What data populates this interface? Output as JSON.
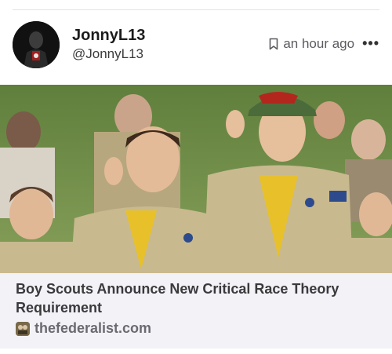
{
  "post": {
    "display_name": "JonnyL13",
    "handle": "@JonnyL13",
    "timestamp": "an hour ago",
    "more_label": "•••"
  },
  "link_card": {
    "title": "Boy Scouts Announce New Critical Race Theory Requirement",
    "source": "thefederalist.com"
  },
  "icons": {
    "bookmark": "bookmark-icon",
    "more": "more-icon",
    "favicon": "site-favicon"
  },
  "colors": {
    "uniform_khaki": "#c8b98f",
    "neckerchief_yellow": "#e8c12a",
    "cap_green": "#4b6b3a",
    "cap_red": "#b3261e"
  }
}
